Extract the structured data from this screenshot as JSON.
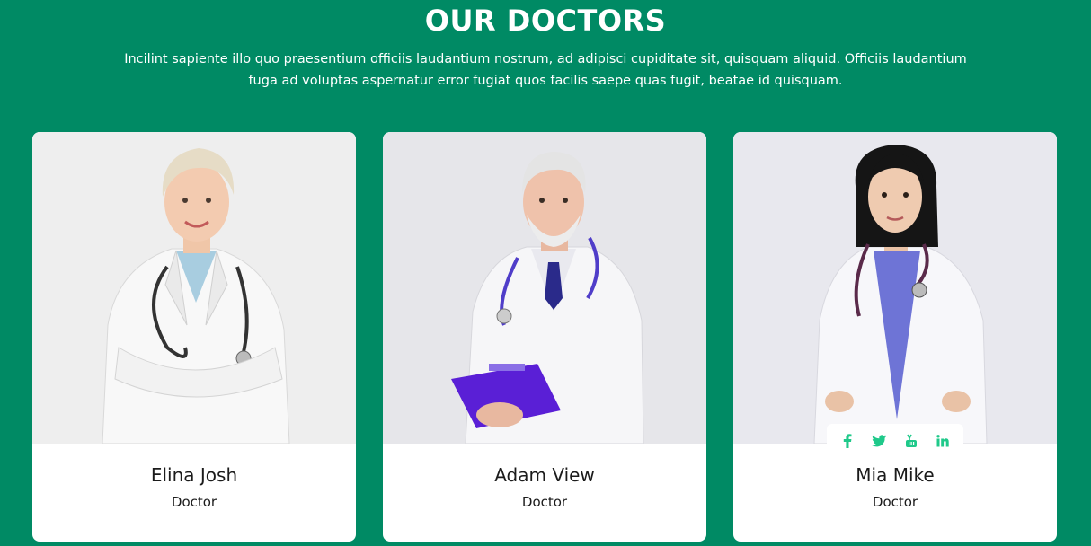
{
  "section": {
    "title": "OUR DOCTORS",
    "intro": "Incilint sapiente illo quo praesentium officiis laudantium nostrum, ad adipisci cupiditate sit, quisquam aliquid. Officiis laudantium fuga ad voluptas aspernatur error fugiat quos facilis saepe quas fugit, beatae id quisquam."
  },
  "colors": {
    "background": "#008a64",
    "card": "#ffffff",
    "social_icon": "#1fc98a"
  },
  "doctors": [
    {
      "name": "Elina Josh",
      "role": "Doctor",
      "photo": "doctor-photo-female-blonde"
    },
    {
      "name": "Adam View",
      "role": "Doctor",
      "photo": "doctor-photo-male-clipboard"
    },
    {
      "name": "Mia Mike",
      "role": "Doctor",
      "photo": "doctor-photo-female-dark-hair",
      "social": [
        "facebook-icon",
        "twitter-icon",
        "youtube-icon",
        "linkedin-icon"
      ]
    }
  ]
}
